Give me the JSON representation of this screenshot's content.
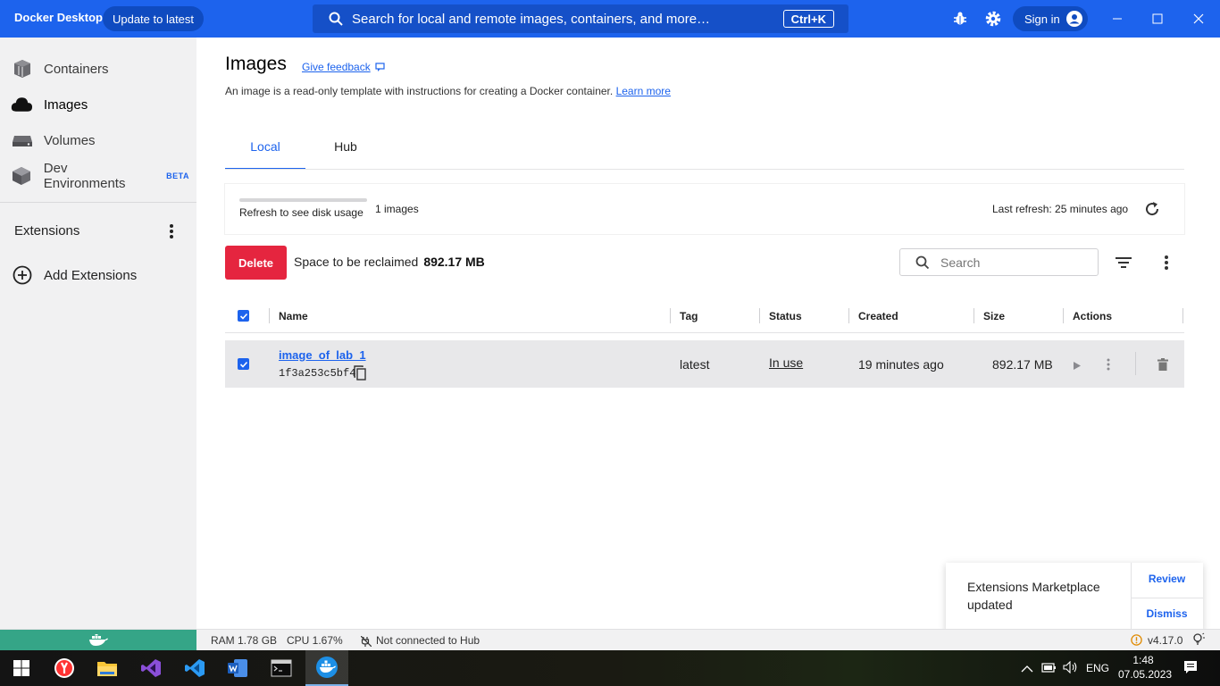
{
  "app": {
    "title": "Docker Desktop",
    "update_label": "Update to latest",
    "search_placeholder": "Search for local and remote images, containers, and more…",
    "shortcut": "Ctrl+K",
    "signin_label": "Sign in"
  },
  "sidebar": {
    "items": [
      {
        "label": "Containers",
        "icon": "container-icon"
      },
      {
        "label": "Images",
        "icon": "cloud-icon"
      },
      {
        "label": "Volumes",
        "icon": "volume-icon"
      },
      {
        "label": "Dev Environments",
        "icon": "cube-icon",
        "badge": "BETA"
      }
    ],
    "extensions_label": "Extensions",
    "add_extensions_label": "Add Extensions"
  },
  "page": {
    "title": "Images",
    "feedback_label": "Give feedback",
    "description": "An image is a read-only template with instructions for creating a Docker container.",
    "learn_more": "Learn more",
    "tabs": [
      {
        "label": "Local",
        "active": true
      },
      {
        "label": "Hub",
        "active": false
      }
    ]
  },
  "disk": {
    "refresh_hint": "Refresh to see disk usage",
    "count": "1 images",
    "last_refresh": "Last refresh: 25 minutes ago"
  },
  "toolbar": {
    "delete_label": "Delete",
    "reclaim_label": "Space to be reclaimed",
    "reclaim_value": "892.17 MB",
    "search_placeholder": "Search"
  },
  "table": {
    "headers": [
      "Name",
      "Tag",
      "Status",
      "Created",
      "Size",
      "Actions"
    ],
    "rows": [
      {
        "name": "image_of_lab_1",
        "id": "1f3a253c5bf4",
        "tag": "latest",
        "status": "In use",
        "created": "19 minutes ago",
        "size": "892.17 MB",
        "checked": true
      }
    ]
  },
  "toast": {
    "message": "Extensions Marketplace updated",
    "review_label": "Review",
    "dismiss_label": "Dismiss"
  },
  "statusbar": {
    "ram": "RAM 1.78 GB",
    "cpu": "CPU 1.67%",
    "hub": "Not connected to Hub",
    "version": "v4.17.0"
  },
  "taskbar": {
    "lang": "ENG",
    "time": "1:48",
    "date": "07.05.2023"
  },
  "colors": {
    "brand": "#1d63ed",
    "danger": "#e5253f",
    "engine_running": "#35a587"
  }
}
